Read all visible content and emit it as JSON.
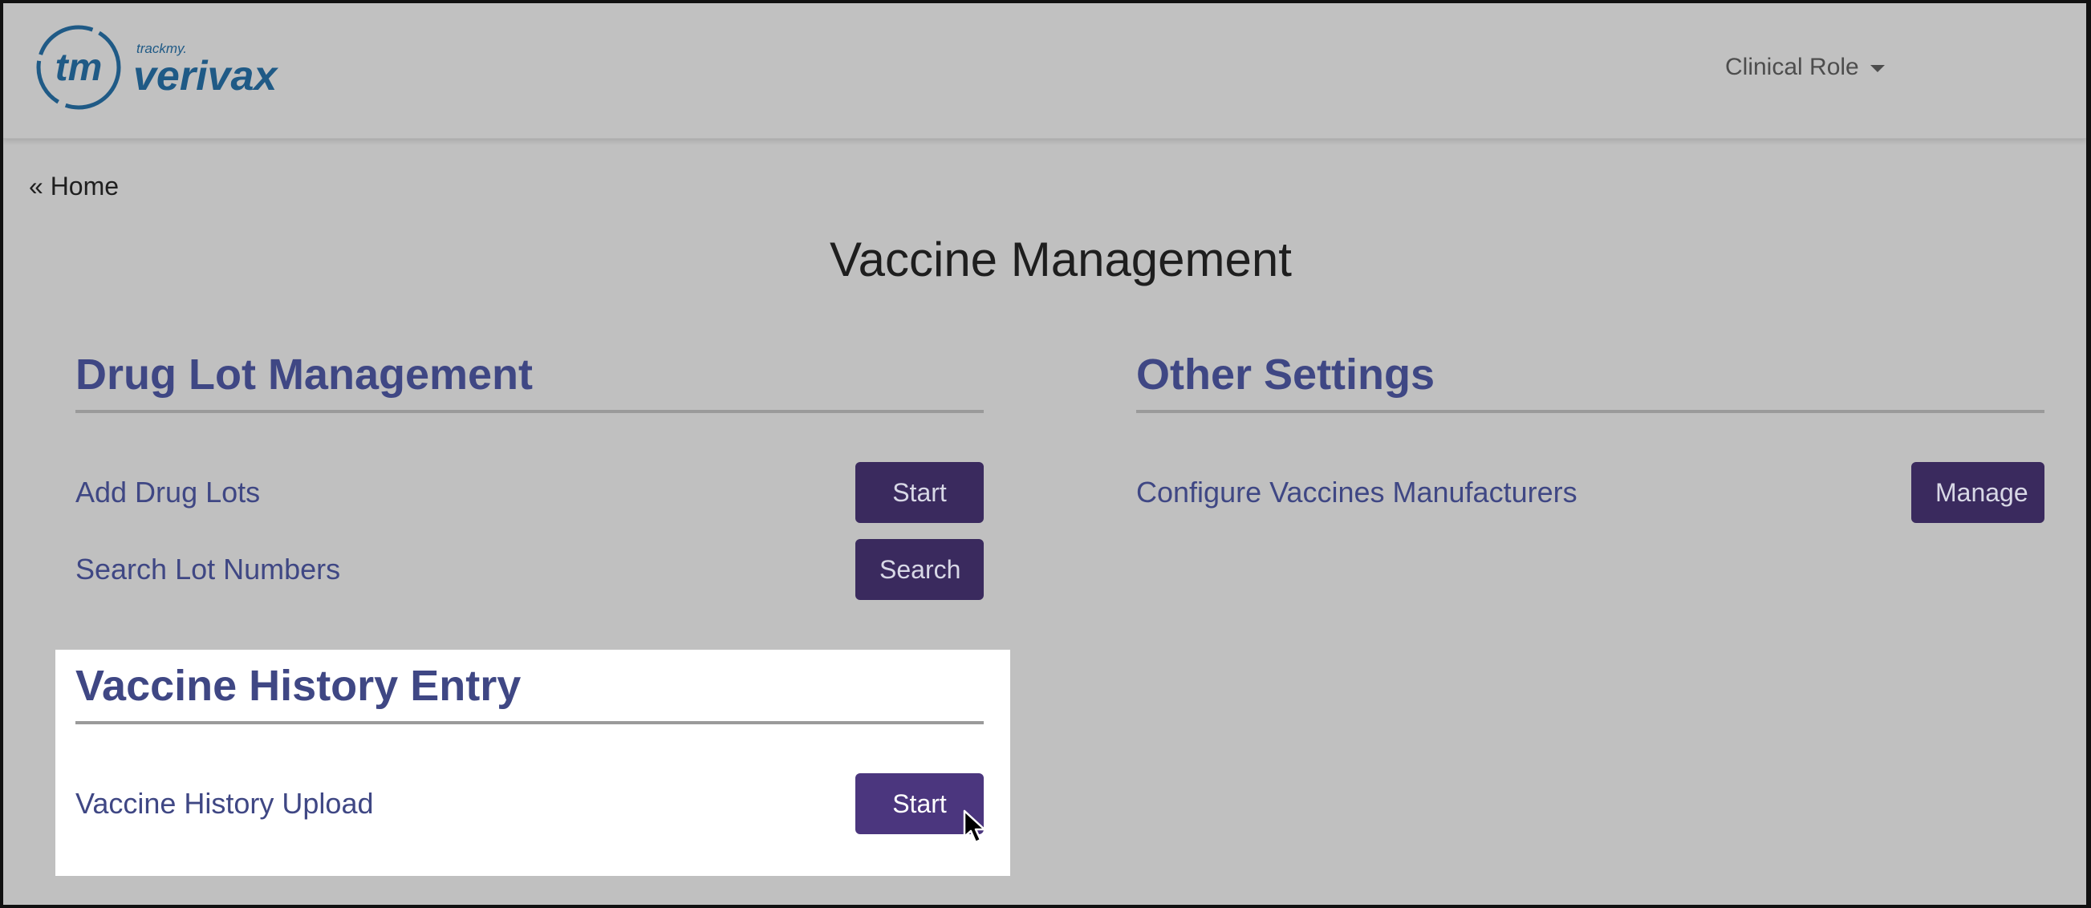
{
  "header": {
    "logo_small_text": "trackmy.",
    "logo_mark": "tm",
    "logo_brand": "verivax",
    "role_menu_label": "Clinical Role"
  },
  "nav": {
    "back_label": "« Home"
  },
  "page": {
    "title": "Vaccine Management"
  },
  "sections": {
    "drug_lot": {
      "title": "Drug Lot Management",
      "rows": [
        {
          "label": "Add Drug Lots",
          "button": "Start"
        },
        {
          "label": "Search Lot Numbers",
          "button": "Search"
        }
      ]
    },
    "other": {
      "title": "Other Settings",
      "rows": [
        {
          "label": "Configure Vaccines Manufacturers",
          "button": "Manage"
        }
      ]
    },
    "history": {
      "title": "Vaccine History Entry",
      "rows": [
        {
          "label": "Vaccine History Upload",
          "button": "Start"
        }
      ]
    }
  },
  "colors": {
    "accent_text": "#3f4784",
    "button": "#3a2a5e",
    "button_active": "#4b367e",
    "logo": "#1f5a86",
    "overlay_bg": "#c0c0c0"
  },
  "icons": [
    "trackmy-verivax-logo",
    "caret-down-icon",
    "mouse-pointer-icon"
  ]
}
